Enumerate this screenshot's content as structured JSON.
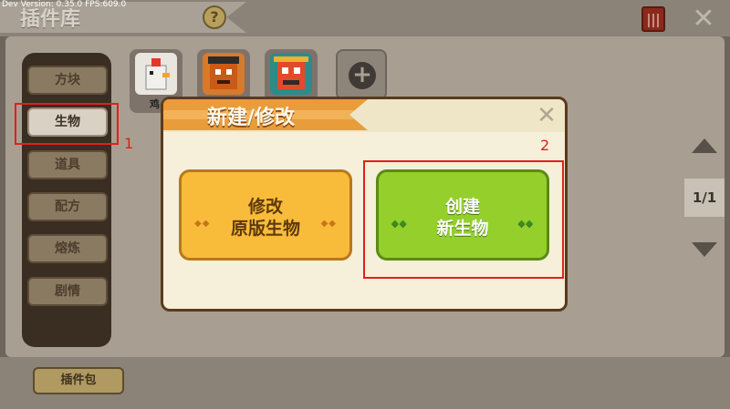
{
  "debug": {
    "text": "Dev Version: 0.35.0      FPS:609.0"
  },
  "header": {
    "title": "插件库",
    "help_label": "?",
    "close_label": "✕"
  },
  "sidebar": {
    "items": [
      {
        "label": "方块"
      },
      {
        "label": "生物"
      },
      {
        "label": "道具"
      },
      {
        "label": "配方"
      },
      {
        "label": "熔炼"
      },
      {
        "label": "剧情"
      }
    ]
  },
  "tiles": [
    {
      "label": "鸡",
      "icon": "chicken-icon"
    },
    {
      "label": "",
      "icon": "creature-icon-1"
    },
    {
      "label": "",
      "icon": "creature-icon-2"
    }
  ],
  "add_tile": {
    "label": "+"
  },
  "pager": {
    "label": "1/1"
  },
  "footer": {
    "pack_label": "插件包"
  },
  "annotations": {
    "num1": "1",
    "num2": "2"
  },
  "dialog": {
    "title": "新建/修改",
    "close_label": "✕",
    "modify": {
      "line1": "修改",
      "line2": "原版生物",
      "deco": "◆◆"
    },
    "create": {
      "line1": "创建",
      "line2": "新生物",
      "deco": "◆◆"
    }
  },
  "colors": {
    "annotation_red": "#e0201c",
    "dialog_bg": "#f6efd9",
    "orange": "#f8bc3a",
    "green": "#94cf2c"
  }
}
